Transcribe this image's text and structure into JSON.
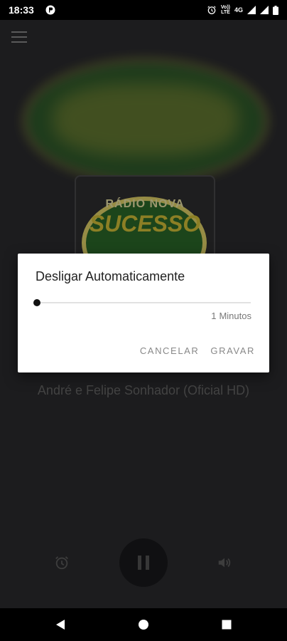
{
  "status_bar": {
    "time": "18:33",
    "volte_line1": "Vo))",
    "volte_line2": "LTE",
    "network": "4G"
  },
  "album": {
    "logo_top": "RÁDIO NOVA",
    "logo_main": "SUCESSO"
  },
  "player": {
    "song_title": "André e Felipe Sonhador (Oficial HD)"
  },
  "dialog": {
    "title": "Desligar Automaticamente",
    "slider_value": 1,
    "slider_unit": "Minutos",
    "cancel_label": "CANCELAR",
    "confirm_label": "GRAVAR"
  },
  "icons": {
    "menu": "menu-icon",
    "alarm": "alarm-icon",
    "pause": "pause-icon",
    "volume": "volume-icon",
    "back": "back-icon",
    "home": "home-icon",
    "recents": "recents-icon"
  },
  "colors": {
    "background": "#2b2b2e",
    "logo_green": "#2c6a2a",
    "logo_yellow": "#d8c43a"
  }
}
